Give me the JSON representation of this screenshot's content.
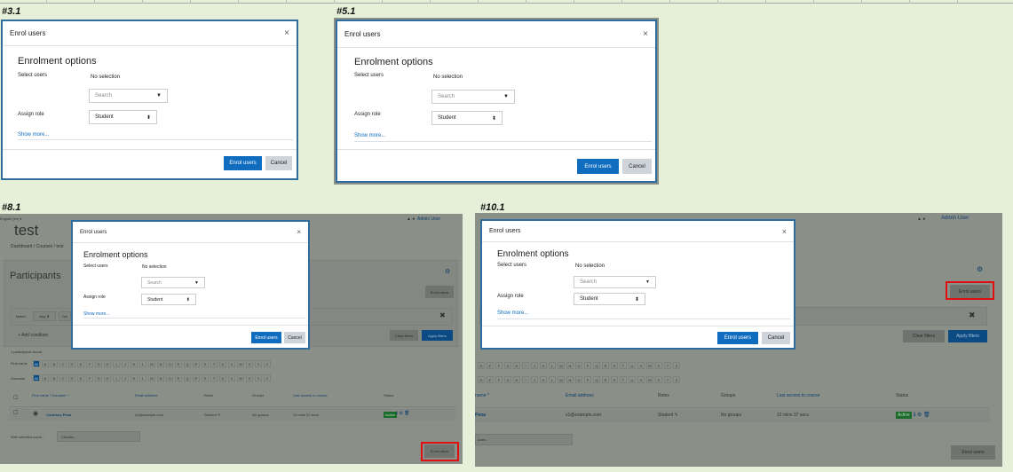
{
  "panels": {
    "p1": {
      "label": "#3.1"
    },
    "p2": {
      "label": "#5.1"
    },
    "p3": {
      "label": "#8.1"
    },
    "p4": {
      "label": "#10.1"
    }
  },
  "dialog": {
    "title": "Enrol users",
    "close": "×",
    "heading": "Enrolment options",
    "select_users_label": "Select users",
    "no_selection": "No selection",
    "search_placeholder": "Search",
    "search_arrow": "▼",
    "assign_role_label": "Assign role",
    "role_value": "Student",
    "role_arrow": "⬍",
    "show_more": "Show more...",
    "enrol_button": "Enrol users",
    "cancel_button": "Cancel"
  },
  "page": {
    "course_title": "test",
    "language": "English (en) ▾",
    "breadcrumb": "Dashboard / Courses / test",
    "admin_user": "Admin User",
    "participants_title": "Participants",
    "enrol_users_button": "Enrol users",
    "match_label": "Match",
    "match_value": "Any ⬍",
    "select_value": "Sel",
    "add_condition": "+ Add condition",
    "clear_filters": "Clear filters",
    "apply_filters": "Apply filters",
    "participants_found": "1 participants found",
    "first_name_label": "First name",
    "surname_label": "Surname",
    "all_label": "All",
    "letters_p3": [
      "A",
      "B",
      "C",
      "D",
      "E",
      "F",
      "G",
      "H",
      "I",
      "J",
      "K",
      "L",
      "M",
      "N",
      "O",
      "P",
      "Q",
      "R",
      "S",
      "T",
      "U",
      "V",
      "W",
      "X",
      "Y",
      "Z"
    ],
    "letters_p4": [
      "D",
      "E",
      "F",
      "G",
      "H",
      "I",
      "J",
      "K",
      "L",
      "M",
      "N",
      "O",
      "P",
      "Q",
      "R",
      "S",
      "T",
      "U",
      "V",
      "W",
      "X",
      "Y",
      "Z"
    ],
    "columns": {
      "name": "First name / Surname ^",
      "name_short": "name ^",
      "email": "Email address",
      "roles": "Roles",
      "groups": "Groups",
      "last_access": "Last access to course",
      "status": "Status"
    },
    "row": {
      "name": "Courtney Pena",
      "name_short": "Pena",
      "email": "s1@example.com",
      "role": "Student ✎",
      "groups": "No groups",
      "last_access": "12 mins 37 secs",
      "status": "Active"
    },
    "with_selected": "With selected users...",
    "choose": "Choose...",
    "choose_short": "oose...",
    "dash": "–"
  },
  "colors": {
    "accent": "#0f6cbf",
    "highlight": "#e01010",
    "dialog_border": "#2e6d9e",
    "background": "#e6f0d8"
  }
}
